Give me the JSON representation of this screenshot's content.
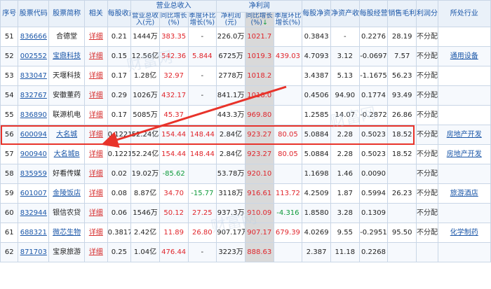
{
  "header": {
    "seq": "序号",
    "code": "股票代码",
    "name": "股票简称",
    "related": "相关",
    "eps": "每股收益(元)",
    "revenue_group": "营业总收入",
    "revenue": "营业总收入(元)",
    "rev_yoy": "同比增长(%)",
    "rev_qoq": "季度环比增长(%)",
    "profit_group": "净利润",
    "profit": "净利润(元)",
    "profit_yoy": "同比增长(%)",
    "profit_qoq": "季度环比增长(%)",
    "bvps": "每股净资产(元)",
    "roe": "净资产收益率(%)",
    "ocfps": "每股经营现金流量(元)",
    "gross_margin": "销售毛利率(%)",
    "dividend": "利润分配",
    "industry": "所处行业"
  },
  "sort_indicator": "↓",
  "rows": [
    {
      "seq": "51",
      "code": "836666",
      "name": "合德堂",
      "name_linked": false,
      "related": "详细",
      "eps": "0.21",
      "revenue": "1444万",
      "rev_yoy": "383.35",
      "rev_qoq": "-",
      "profit": "226.0万",
      "profit_yoy": "1021.7",
      "profit_qoq": "",
      "bvps": "0.3843",
      "roe": "-",
      "ocfps": "0.2276",
      "gross_margin": "28.19",
      "dividend": "不分配不转增",
      "industry": ""
    },
    {
      "seq": "52",
      "code": "002552",
      "name": "宝鼎科技",
      "name_linked": true,
      "related": "详细",
      "eps": "0.15",
      "revenue": "12.56亿",
      "rev_yoy": "542.36",
      "rev_qoq": "5.844",
      "profit": "6725万",
      "profit_yoy": "1019.3",
      "profit_qoq": "439.03",
      "bvps": "4.7093",
      "roe": "3.12",
      "ocfps": "-0.0697",
      "gross_margin": "7.57",
      "dividend": "不分配不转增",
      "industry": "通用设备"
    },
    {
      "seq": "53",
      "code": "833047",
      "name": "天堰科技",
      "name_linked": false,
      "related": "详细",
      "eps": "0.17",
      "revenue": "1.28亿",
      "rev_yoy": "32.97",
      "rev_qoq": "-",
      "profit": "2778万",
      "profit_yoy": "1018.2",
      "profit_qoq": "",
      "bvps": "3.4387",
      "roe": "5.13",
      "ocfps": "-1.1675",
      "gross_margin": "56.23",
      "dividend": "不分配不转增",
      "industry": ""
    },
    {
      "seq": "54",
      "code": "832767",
      "name": "安徽董药",
      "name_linked": false,
      "related": "详细",
      "eps": "0.29",
      "revenue": "1026万",
      "rev_yoy": "432.17",
      "rev_qoq": "-",
      "profit": "841.1万",
      "profit_yoy": "1018.0",
      "profit_qoq": "",
      "bvps": "0.4506",
      "roe": "94.90",
      "ocfps": "0.1774",
      "gross_margin": "93.49",
      "dividend": "不分配不转增",
      "industry": ""
    },
    {
      "seq": "55",
      "code": "836890",
      "name": "联源机电",
      "name_linked": false,
      "related": "详细",
      "eps": "0.17",
      "revenue": "5085万",
      "rev_yoy": "45.37",
      "rev_qoq": "",
      "profit": "443.3万",
      "profit_yoy": "969.80",
      "profit_qoq": "",
      "bvps": "1.2585",
      "roe": "14.07",
      "ocfps": "-0.2872",
      "gross_margin": "26.86",
      "dividend": "不分配不转增",
      "industry": ""
    },
    {
      "seq": "56",
      "code": "600094",
      "name": "大名城",
      "name_linked": true,
      "related": "详细",
      "eps": "0.1221",
      "revenue": "52.24亿",
      "rev_yoy": "154.44",
      "rev_qoq": "148.44",
      "profit": "2.84亿",
      "profit_yoy": "923.27",
      "profit_qoq": "80.05",
      "bvps": "5.0884",
      "roe": "2.28",
      "ocfps": "0.5023",
      "gross_margin": "18.52",
      "dividend": "不分配不转增",
      "industry": "房地产开发"
    },
    {
      "seq": "57",
      "code": "900940",
      "name": "大名城B",
      "name_linked": true,
      "related": "详细",
      "eps": "0.1221",
      "revenue": "52.24亿",
      "rev_yoy": "154.44",
      "rev_qoq": "148.44",
      "profit": "2.84亿",
      "profit_yoy": "923.27",
      "profit_qoq": "80.05",
      "bvps": "5.0884",
      "roe": "2.28",
      "ocfps": "0.5023",
      "gross_margin": "18.52",
      "dividend": "不分配不转增",
      "industry": "房地产开发"
    },
    {
      "seq": "58",
      "code": "835959",
      "name": "好看传媒",
      "name_linked": false,
      "related": "详细",
      "eps": "0.02",
      "revenue": "19.02万",
      "rev_yoy": "-85.62",
      "rev_qoq": "",
      "profit": "53.78万",
      "profit_yoy": "920.10",
      "profit_qoq": "",
      "bvps": "1.1698",
      "roe": "1.46",
      "ocfps": "0.0090",
      "gross_margin": "",
      "dividend": "不分配不转增",
      "industry": ""
    },
    {
      "seq": "59",
      "code": "601007",
      "name": "金陵饭店",
      "name_linked": true,
      "related": "详细",
      "eps": "0.08",
      "revenue": "8.87亿",
      "rev_yoy": "34.70",
      "rev_qoq": "-15.77",
      "profit": "3118万",
      "profit_yoy": "916.61",
      "profit_qoq": "113.72",
      "bvps": "4.2509",
      "roe": "1.87",
      "ocfps": "0.5994",
      "gross_margin": "26.23",
      "dividend": "不分配不转增",
      "industry": "旅游酒店"
    },
    {
      "seq": "60",
      "code": "832944",
      "name": "银信农贷",
      "name_linked": false,
      "related": "详细",
      "eps": "0.06",
      "revenue": "1546万",
      "rev_yoy": "50.12",
      "rev_qoq": "27.25",
      "profit": "937.3万",
      "profit_yoy": "910.09",
      "profit_qoq": "-4.316",
      "bvps": "1.8580",
      "roe": "3.28",
      "ocfps": "0.1309",
      "gross_margin": "",
      "dividend": "不分配不转增",
      "industry": ""
    },
    {
      "seq": "61",
      "code": "688321",
      "name": "微芯生物",
      "name_linked": true,
      "related": "详细",
      "eps": "0.3817",
      "revenue": "2.42亿",
      "rev_yoy": "11.89",
      "rev_qoq": "26.80",
      "profit": "907.17万",
      "profit_yoy": "907.17",
      "profit_qoq": "679.39",
      "bvps": "4.0269",
      "roe": "9.55",
      "ocfps": "-0.2951",
      "gross_margin": "95.50",
      "dividend": "不分配不转增",
      "industry": "化学制药"
    },
    {
      "seq": "62",
      "code": "871703",
      "name": "宝泉旅游",
      "name_linked": false,
      "related": "详细",
      "eps": "0.25",
      "revenue": "1.04亿",
      "rev_yoy": "476.44",
      "rev_qoq": "-",
      "profit": "3223万",
      "profit_yoy": "888.63",
      "profit_qoq": "",
      "bvps": "2.387",
      "roe": "11.18",
      "ocfps": "0.2268",
      "gross_margin": "",
      "dividend": "",
      "industry": ""
    }
  ],
  "highlight_row_index": 5,
  "highlight_color": "#e8332a",
  "watermark": "财富网"
}
